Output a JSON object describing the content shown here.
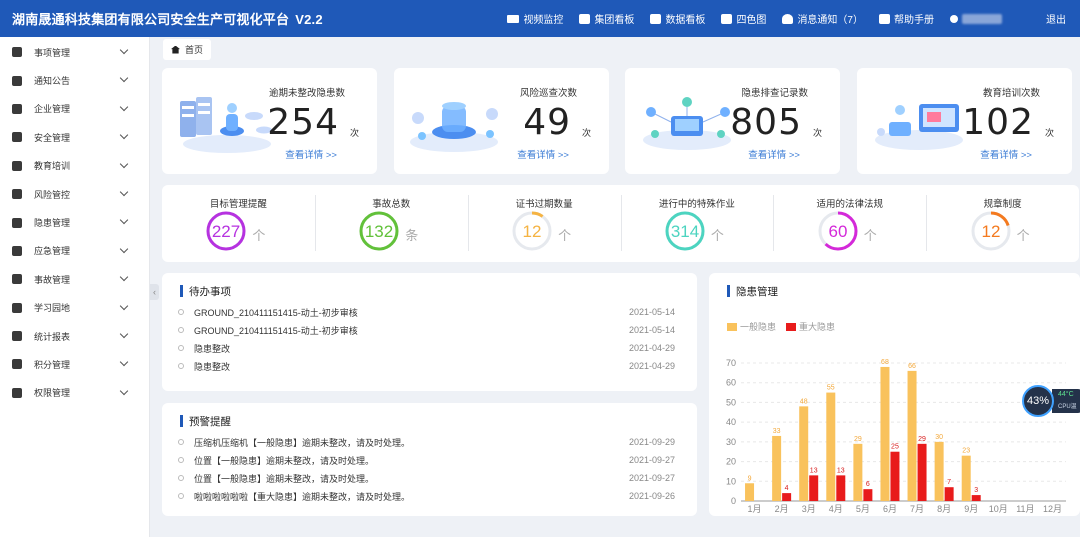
{
  "app": {
    "title": "湖南晟通科技集团有限公司安全生产可视化平台",
    "version": "V2.2"
  },
  "topnav": [
    {
      "name": "nav-video-monitor",
      "label": "视频监控"
    },
    {
      "name": "nav-group-board",
      "label": "集团看板"
    },
    {
      "name": "nav-data-board",
      "label": "数据看板"
    },
    {
      "name": "nav-four-color-map",
      "label": "四色图"
    },
    {
      "name": "nav-notifications",
      "label": "消息通知（7）"
    },
    {
      "name": "nav-help-manual",
      "label": "帮助手册"
    }
  ],
  "logout": "退出",
  "sidebar": {
    "items": [
      {
        "label": "事项管理",
        "icon": "document-icon"
      },
      {
        "label": "通知公告",
        "icon": "bell-icon"
      },
      {
        "label": "企业管理",
        "icon": "building-icon"
      },
      {
        "label": "安全管理",
        "icon": "shield-icon"
      },
      {
        "label": "教育培训",
        "icon": "graduation-cap-icon"
      },
      {
        "label": "风险管控",
        "icon": "risk-icon"
      },
      {
        "label": "隐患管理",
        "icon": "hazard-icon"
      },
      {
        "label": "应急管理",
        "icon": "user-alert-icon"
      },
      {
        "label": "事故管理",
        "icon": "clipboard-icon"
      },
      {
        "label": "学习园地",
        "icon": "book-icon"
      },
      {
        "label": "统计报表",
        "icon": "bar-chart-icon"
      },
      {
        "label": "积分管理",
        "icon": "database-icon"
      },
      {
        "label": "权限管理",
        "icon": "lock-file-icon"
      }
    ]
  },
  "breadcrumb": {
    "home": "首页"
  },
  "stats": [
    {
      "label": "逾期未整改隐患数",
      "value": "254",
      "unit": "次",
      "link": "查看详情 >>"
    },
    {
      "label": "风险巡查次数",
      "value": "49",
      "unit": "次",
      "link": "查看详情 >>"
    },
    {
      "label": "隐患排查记录数",
      "value": "805",
      "unit": "次",
      "link": "查看详情 >>"
    },
    {
      "label": "教育培训次数",
      "value": "102",
      "unit": "次",
      "link": "查看详情 >>"
    }
  ],
  "rings": [
    {
      "label": "目标管理提醒",
      "value": "227",
      "unit": "个",
      "color": "#b632e0",
      "fill": 1.0
    },
    {
      "label": "事故总数",
      "value": "132",
      "unit": "条",
      "color": "#62c13a",
      "fill": 1.0
    },
    {
      "label": "证书过期数量",
      "value": "12",
      "unit": "个",
      "color": "#f5b342",
      "fill": 0.1
    },
    {
      "label": "进行中的特殊作业",
      "value": "314",
      "unit": "个",
      "color": "#4cd4c0",
      "fill": 1.0
    },
    {
      "label": "适用的法律法规",
      "value": "60",
      "unit": "个",
      "color": "#d429d9",
      "fill": 0.62
    },
    {
      "label": "规章制度",
      "value": "12",
      "unit": "个",
      "color": "#f47a1f",
      "fill": 0.2
    }
  ],
  "todo": {
    "title": "待办事项",
    "items": [
      {
        "text": "GROUND_210411151415-动土-初步审核",
        "date": "2021-05-14"
      },
      {
        "text": "GROUND_210411151415-动土-初步审核",
        "date": "2021-05-14"
      },
      {
        "text": "隐患整改",
        "date": "2021-04-29"
      },
      {
        "text": "隐患整改",
        "date": "2021-04-29"
      }
    ]
  },
  "warning": {
    "title": "预警提醒",
    "items": [
      {
        "text": "压缩机压缩机【一般隐患】逾期未整改，请及时处理。",
        "date": "2021-09-29"
      },
      {
        "text": "位置【一般隐患】逾期未整改，请及时处理。",
        "date": "2021-09-27"
      },
      {
        "text": "位置【一般隐患】逾期未整改，请及时处理。",
        "date": "2021-09-27"
      },
      {
        "text": "啦啦啦啦啦啦【重大隐患】逾期未整改，请及时处理。",
        "date": "2021-09-26"
      }
    ]
  },
  "hazard_panel": {
    "title": "隐患管理"
  },
  "chart_data": {
    "type": "bar",
    "categories": [
      "1月",
      "2月",
      "3月",
      "4月",
      "5月",
      "6月",
      "7月",
      "8月",
      "9月",
      "10月",
      "11月",
      "12月"
    ],
    "series": [
      {
        "name": "一般隐患",
        "color": "#f9c25c",
        "values": [
          9,
          33,
          48,
          55,
          29,
          68,
          66,
          30,
          23,
          0,
          0,
          0
        ]
      },
      {
        "name": "重大隐患",
        "color": "#e81b1b",
        "values": [
          0,
          4,
          13,
          13,
          6,
          25,
          29,
          7,
          3,
          0,
          0,
          0
        ]
      }
    ],
    "value_labels": {
      "一般隐患": [
        "9",
        "33",
        "48",
        "55",
        "29",
        "68",
        "66",
        "30",
        "23",
        "",
        "",
        ""
      ],
      "重大隐患": [
        "",
        "4",
        "13",
        "13",
        "6",
        "25",
        "29",
        "7",
        "3",
        "",
        "",
        ""
      ]
    },
    "ylim": [
      0,
      70
    ],
    "yticks": [
      "0",
      "10",
      "20",
      "30",
      "40",
      "50",
      "60",
      "70"
    ],
    "grid": true,
    "legend": "top-left"
  },
  "cpu_widget": {
    "percent": "43%",
    "temp": "44°C",
    "label": "CPU温"
  }
}
